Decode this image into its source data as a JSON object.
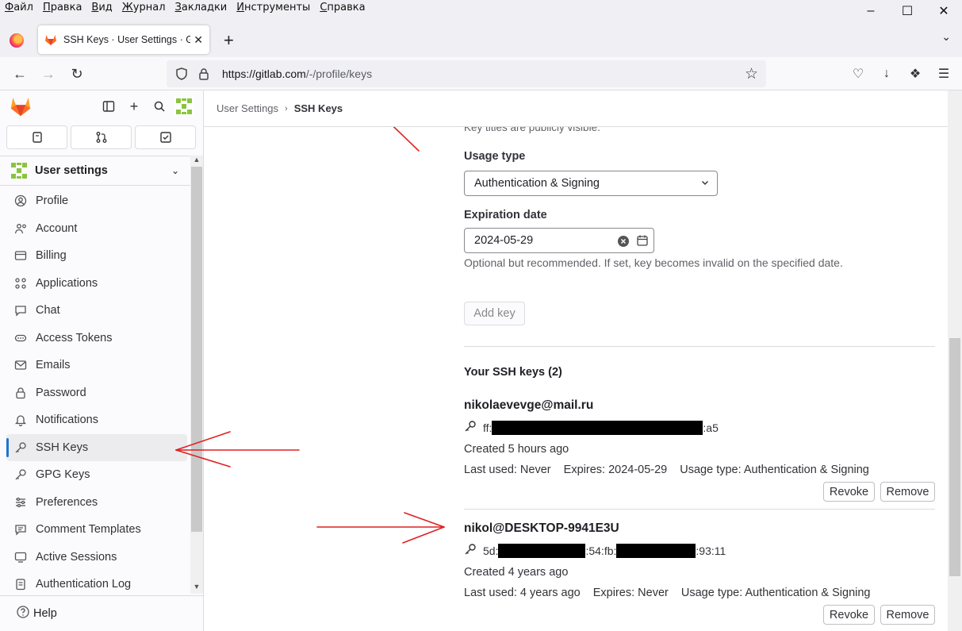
{
  "browser": {
    "menu": [
      "Файл",
      "Правка",
      "Вид",
      "Журнал",
      "Закладки",
      "Инструменты",
      "Справка"
    ],
    "tab_title": "SSH Keys · User Settings · GitLab",
    "url_domain": "https://gitlab.com",
    "url_path": "/-/profile/keys"
  },
  "sidebar": {
    "context_title": "User settings",
    "items": [
      {
        "label": "Profile",
        "icon": "profile-icon"
      },
      {
        "label": "Account",
        "icon": "account-icon"
      },
      {
        "label": "Billing",
        "icon": "billing-icon"
      },
      {
        "label": "Applications",
        "icon": "applications-icon"
      },
      {
        "label": "Chat",
        "icon": "chat-icon"
      },
      {
        "label": "Access Tokens",
        "icon": "token-icon"
      },
      {
        "label": "Emails",
        "icon": "mail-icon"
      },
      {
        "label": "Password",
        "icon": "lock-icon"
      },
      {
        "label": "Notifications",
        "icon": "bell-icon"
      },
      {
        "label": "SSH Keys",
        "icon": "key-icon",
        "active": true
      },
      {
        "label": "GPG Keys",
        "icon": "key-icon"
      },
      {
        "label": "Preferences",
        "icon": "preferences-icon"
      },
      {
        "label": "Comment Templates",
        "icon": "comment-icon"
      },
      {
        "label": "Active Sessions",
        "icon": "sessions-icon"
      },
      {
        "label": "Authentication Log",
        "icon": "log-icon"
      }
    ],
    "help": "Help"
  },
  "breadcrumb": {
    "parent": "User Settings",
    "current": "SSH Keys"
  },
  "form": {
    "title_hint": "Key titles are publicly visible.",
    "usage_type_label": "Usage type",
    "usage_type_value": "Authentication & Signing",
    "expiration_label": "Expiration date",
    "expiration_value": "2024-05-29",
    "expiration_help": "Optional but recommended. If set, key becomes invalid on the specified date.",
    "add_key": "Add key"
  },
  "keys_section": {
    "title": "Your SSH keys (2)",
    "keys": [
      {
        "title": "nikolaevevge@mail.ru",
        "fp_start": "ff:",
        "fp_end": ":a5",
        "created": "Created 5 hours ago",
        "last_used": "Last used: Never",
        "expires": "Expires: 2024-05-29",
        "usage": "Usage type: Authentication & Signing",
        "revoke": "Revoke",
        "remove": "Remove"
      },
      {
        "title": "nikol@DESKTOP-9941E3U",
        "fp_start": "5d:",
        "fp_mid": ":54:fb:",
        "fp_end": ":93:11",
        "created": "Created 4 years ago",
        "last_used": "Last used: 4 years ago",
        "expires": "Expires: Never",
        "usage": "Usage type: Authentication & Signing",
        "revoke": "Revoke",
        "remove": "Remove"
      }
    ]
  },
  "colors": {
    "accent": "#1f75cb",
    "annotation_arrow": "#e02020",
    "gitlab_orange": "#fc6d26"
  }
}
